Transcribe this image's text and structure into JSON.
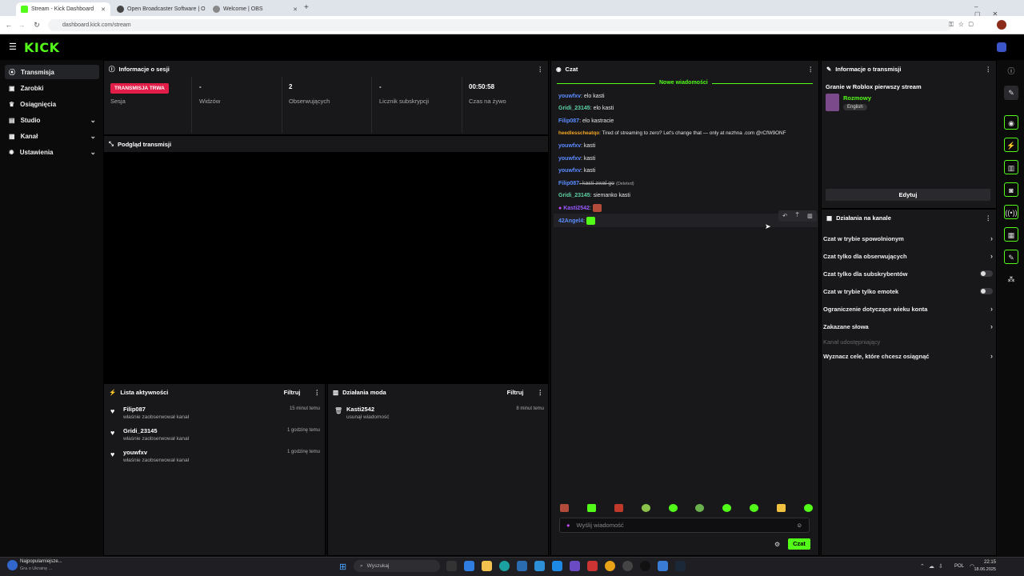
{
  "browser": {
    "tabs": [
      {
        "title": "Stream - Kick Dashboard",
        "active": true,
        "color": "#53fc18"
      },
      {
        "title": "Open Broadcaster Software | O",
        "active": false,
        "color": "#444"
      },
      {
        "title": "Welcome | OBS",
        "active": false,
        "color": "#888"
      }
    ],
    "new_tab": "+",
    "url": "dashboard.kick.com/stream"
  },
  "logo": "KICK",
  "sidebar": {
    "items": [
      {
        "label": "Transmisja",
        "icon": "broadcast-icon",
        "glyph": "⦿"
      },
      {
        "label": "Zarobki",
        "icon": "earnings-icon",
        "glyph": "▣"
      },
      {
        "label": "Osiągnięcia",
        "icon": "trophy-icon",
        "glyph": "♛"
      },
      {
        "label": "Studio",
        "icon": "studio-icon",
        "glyph": "▤"
      },
      {
        "label": "Kanał",
        "icon": "channel-icon",
        "glyph": "▦"
      },
      {
        "label": "Ustawienia",
        "icon": "settings-icon",
        "glyph": "✹"
      }
    ]
  },
  "session": {
    "title": "Informacje o sesji",
    "badge": "TRANSMISJA TRWA",
    "badge_label": "Sesja",
    "stats": [
      {
        "value": "-",
        "label": "Widzów"
      },
      {
        "value": "2",
        "label": "Obserwujących"
      },
      {
        "value": "-",
        "label": "Licznik subskrypcji"
      },
      {
        "value": "00:50:58",
        "label": "Czas na żywo"
      }
    ]
  },
  "preview": {
    "title": "Podgląd transmisji"
  },
  "activity": {
    "title": "Lista aktywności",
    "filter": "Filtruj",
    "items": [
      {
        "name": "Filip087",
        "action": "właśnie zaobserwował kanał",
        "time": "15 minut temu"
      },
      {
        "name": "Gridi_23145",
        "action": "właśnie zaobserwował kanał",
        "time": "1 godzinę temu"
      },
      {
        "name": "youwfxv",
        "action": "właśnie zaobserwował kanał",
        "time": "1 godzinę temu"
      }
    ]
  },
  "mod": {
    "title": "Działania moda",
    "filter": "Filtruj",
    "items": [
      {
        "name": "Kasti2542",
        "action": "usunął wiadomość",
        "time": "8 minut temu"
      }
    ]
  },
  "chat": {
    "title": "Czat",
    "new_messages": "Nowe wiadomości",
    "messages": [
      {
        "user": "youwfxv",
        "color": "#5b8cff",
        "text": ": elo kasti"
      },
      {
        "user": "Gridi_23145",
        "color": "#5fd3a5",
        "text": ": elo kasti"
      },
      {
        "user": "Filip087",
        "color": "#5b8cff",
        "text": ": elo kastracie"
      },
      {
        "user": "heedlesscheatqo",
        "color": "#f5a623",
        "text": ": Tired of streaming to zero? Let's change that — only at nezhna .com @rCfW9ONF"
      },
      {
        "user": "youwfxv",
        "color": "#5b8cff",
        "text": ": kasti"
      },
      {
        "user": "youwfxv",
        "color": "#5b8cff",
        "text": ": kasti"
      },
      {
        "user": "youwfxv",
        "color": "#5b8cff",
        "text": ": kasti"
      },
      {
        "user": "Filip087",
        "color": "#5b8cff",
        "text": ": kasti zwal go",
        "deleted": "(Deleted)"
      },
      {
        "user": "Gridi_23145",
        "color": "#5fd3a5",
        "text": ": siemanko kasti"
      },
      {
        "user": "Kasti2542",
        "color": "#9b59ff",
        "text": ":"
      },
      {
        "user": "42Angel4",
        "color": "#5b8cff",
        "text": ":"
      }
    ],
    "input_placeholder": "Wyślij wiadomość",
    "send_label": "Czat"
  },
  "stream_info": {
    "title": "Informacje o transmisji",
    "stream_title": "Granie w Roblox pierwszy stream",
    "category": "Rozmowy",
    "language": "English",
    "edit_label": "Edytuj"
  },
  "channel_actions": {
    "title": "Działania na kanale",
    "items": [
      {
        "label": "Czat w trybie spowolnionym",
        "control": "arrow"
      },
      {
        "label": "Czat tylko dla obserwujących",
        "control": "arrow"
      },
      {
        "label": "Czat tylko dla subskrybentów",
        "control": "toggle",
        "on": false
      },
      {
        "label": "Czat w trybie tylko emotek",
        "control": "toggle",
        "on": false
      },
      {
        "label": "Ograniczenie dotyczące wieku konta",
        "control": "arrow"
      },
      {
        "label": "Zakazane słowa",
        "control": "arrow"
      },
      {
        "label": "Kanał udostępniający",
        "control": "disabled"
      },
      {
        "label": "Wyznacz cele, które chcesz osiągnąć",
        "control": "arrow"
      }
    ]
  },
  "taskbar": {
    "news_title": "Najpopularniejsze...",
    "news_sub": "Gra o Ukrainę ...",
    "search_placeholder": "Wyszukaj",
    "lang": "POL",
    "time": "22:15",
    "date": "18.06.2025"
  },
  "colors": {
    "accent": "#53fc18",
    "live": "#e11d48"
  }
}
